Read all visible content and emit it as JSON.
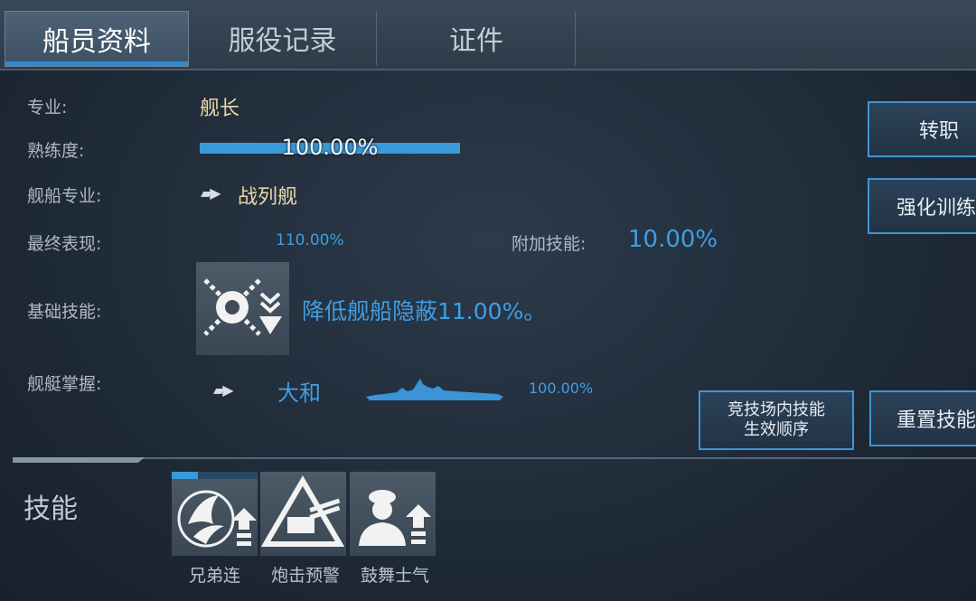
{
  "tabs": [
    {
      "label": "船员资料",
      "active": true
    },
    {
      "label": "服役记录",
      "active": false
    },
    {
      "label": "证件",
      "active": false
    }
  ],
  "profile": {
    "specialty_label": "专业:",
    "specialty_value": "舰长",
    "proficiency_label": "熟练度:",
    "proficiency_value": "100.00%",
    "proficiency_fraction": 1.0,
    "ship_specialty_label": "舰船专业:",
    "ship_specialty_value": "战列舰",
    "final_perf_label": "最终表现:",
    "final_perf_value": "110.00%",
    "extra_skill_label": "附加技能:",
    "extra_skill_value": "10.00%",
    "base_skill_label": "基础技能:",
    "base_skill_desc": "降低舰船隐蔽11.00%。",
    "ship_mastery_label": "舰艇掌握:",
    "ship_mastery_name": "大和",
    "ship_mastery_value": "100.00%"
  },
  "buttons": {
    "transfer": "转职",
    "training": "强化训练",
    "arena_order": "竞技场内技能\n生效顺序",
    "arena_order_line1": "竞技场内技能",
    "arena_order_line2": "生效顺序",
    "reset_skill": "重置技能"
  },
  "skills_section": {
    "title": "技能",
    "skills": [
      {
        "name": "兄弟连",
        "icon": "brothers-icon",
        "progress": 0.3
      },
      {
        "name": "炮击预警",
        "icon": "gun-warning-icon"
      },
      {
        "name": "鼓舞士气",
        "icon": "morale-icon"
      }
    ]
  },
  "colors": {
    "accent": "#3a9ad9",
    "gold": "#e8d6aa",
    "blue_text": "#3e9ee3"
  }
}
